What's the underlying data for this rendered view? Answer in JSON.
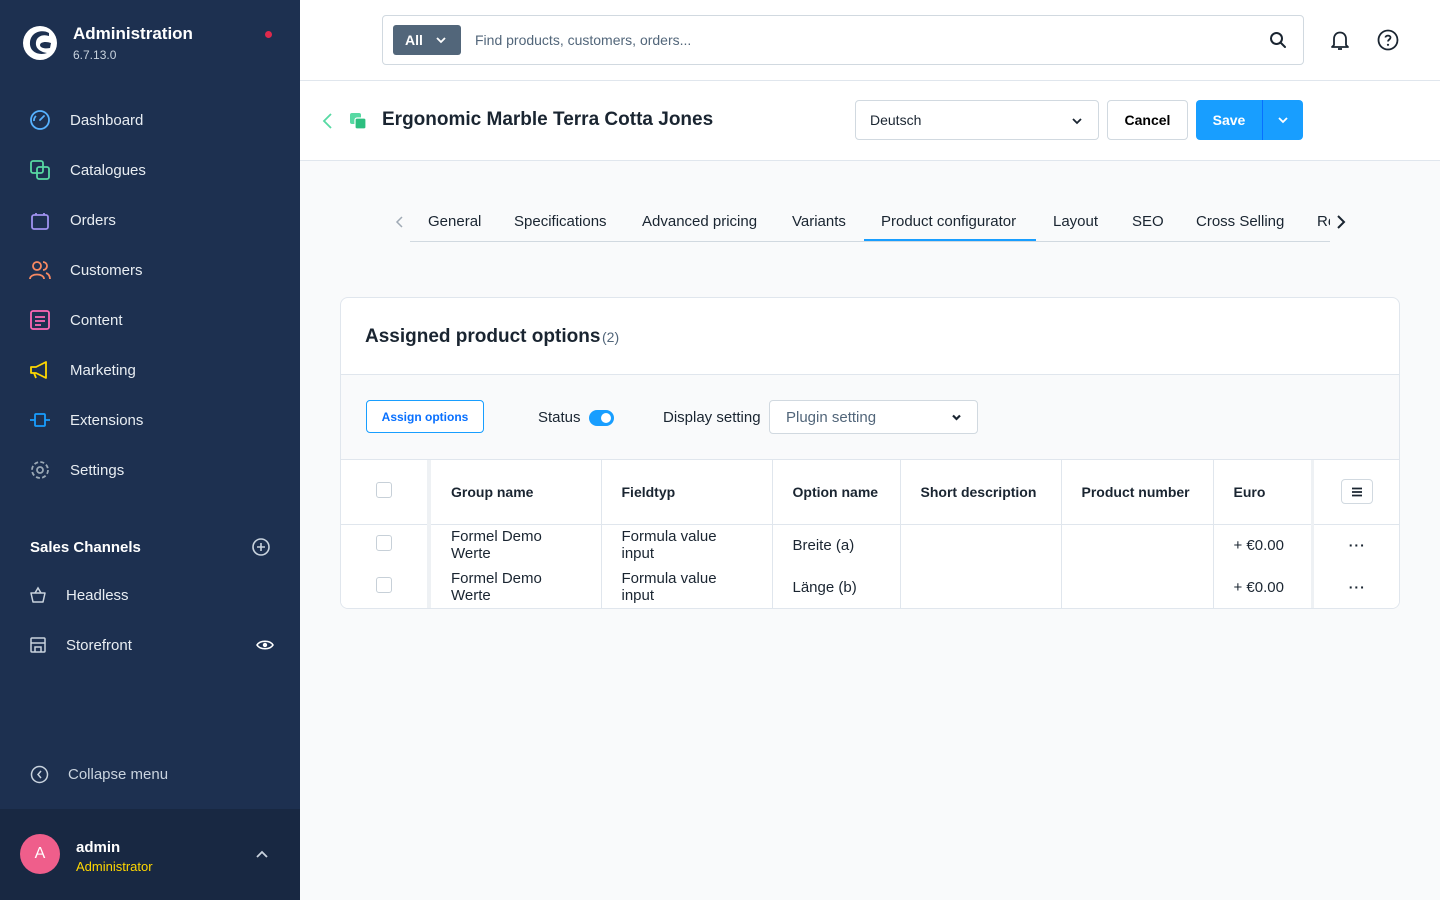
{
  "app": {
    "title": "Administration",
    "version": "6.7.13.0"
  },
  "nav": [
    {
      "label": "Dashboard",
      "icon": "gauge-icon",
      "color": "#56b1ff"
    },
    {
      "label": "Catalogues",
      "icon": "catalogue-icon",
      "color": "#57d9a3"
    },
    {
      "label": "Orders",
      "icon": "shopping-bag-icon",
      "color": "#a092f0"
    },
    {
      "label": "Customers",
      "icon": "users-icon",
      "color": "#f88962"
    },
    {
      "label": "Content",
      "icon": "content-icon",
      "color": "#ff68b4"
    },
    {
      "label": "Marketing",
      "icon": "megaphone-icon",
      "color": "#ffd700"
    },
    {
      "label": "Extensions",
      "icon": "plugin-icon",
      "color": "#189eff"
    },
    {
      "label": "Settings",
      "icon": "gear-icon",
      "color": "#9aa8b5"
    }
  ],
  "sales_channels": {
    "title": "Sales Channels",
    "items": [
      {
        "label": "Headless",
        "icon": "basket-icon"
      },
      {
        "label": "Storefront",
        "icon": "storefront-icon"
      }
    ]
  },
  "collapse_label": "Collapse menu",
  "user": {
    "initial": "A",
    "name": "admin",
    "role": "Administrator"
  },
  "search": {
    "type": "All",
    "placeholder": "Find products, customers, orders..."
  },
  "smartbar": {
    "title": "Ergonomic Marble Terra Cotta Jones",
    "language": "Deutsch",
    "cancel": "Cancel",
    "save": "Save"
  },
  "tabs": [
    {
      "label": "General"
    },
    {
      "label": "Specifications"
    },
    {
      "label": "Advanced pricing"
    },
    {
      "label": "Variants"
    },
    {
      "label": "Product configurator",
      "active": true
    },
    {
      "label": "Layout"
    },
    {
      "label": "SEO"
    },
    {
      "label": "Cross Selling"
    },
    {
      "label": "Re"
    }
  ],
  "card": {
    "title": "Assigned product options",
    "count": "(2)",
    "assign_button": "Assign options",
    "status_label": "Status",
    "status_on": true,
    "display_label": "Display setting",
    "display_value": "Plugin setting"
  },
  "table": {
    "columns": [
      "Group name",
      "Fieldtyp",
      "Option name",
      "Short description",
      "Product number",
      "Euro"
    ],
    "rows": [
      [
        "Formel Demo Werte",
        "Formula value input",
        "Breite (a)",
        "",
        "",
        "+ €0.00"
      ],
      [
        "Formel Demo Werte",
        "Formula value input",
        "Länge (b)",
        "",
        "",
        "+ €0.00"
      ]
    ],
    "row_action": "···"
  },
  "colors": {
    "sidebar": "#1d3050",
    "primary": "#189eff",
    "notification_dot": "#de294c"
  }
}
